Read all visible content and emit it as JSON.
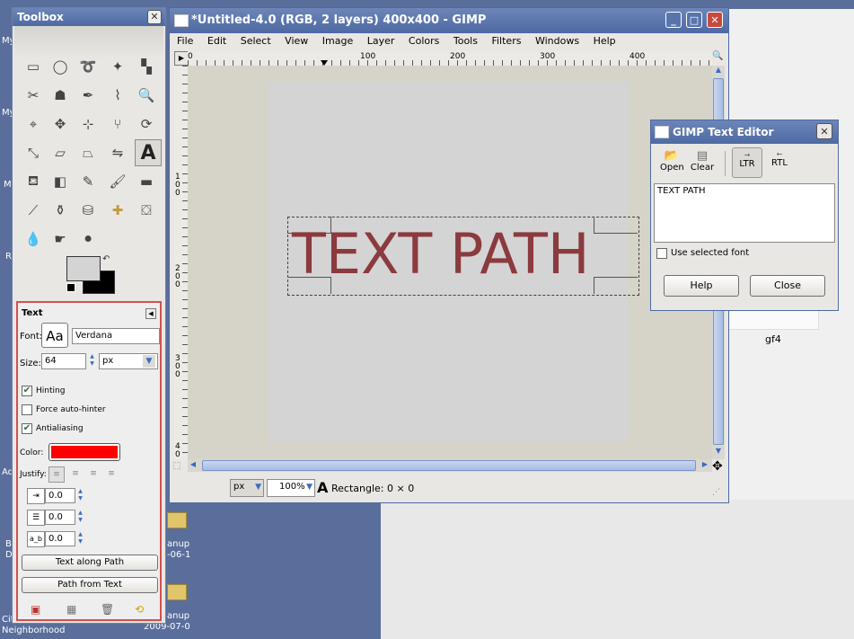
{
  "desktop": {
    "left_labels": [
      "My",
      "My",
      "M",
      "R",
      "Ad",
      "B",
      "D",
      "Cit",
      "Neighborhood"
    ],
    "folders": [
      {
        "line1": "anup",
        "line2": "-06-1"
      },
      {
        "line1": "anup",
        "line2": "2009-07-0"
      }
    ],
    "file_label": "gf4"
  },
  "toolbox": {
    "title": "Toolbox",
    "close": "✕",
    "tool_options": {
      "title": "Text",
      "font_label": "Font:",
      "font_preview": "Aa",
      "font_value": "Verdana",
      "size_label": "Size:",
      "size_value": "64",
      "unit_value": "px",
      "hinting_label": "Hinting",
      "hinting": "✔",
      "force_autohinter_label": "Force auto-hinter",
      "force_autohinter": "",
      "antialiasing_label": "Antialiasing",
      "antialiasing": "✔",
      "color_label": "Color:",
      "color_value": "#ff0000",
      "justify_label": "Justify:",
      "indent_value": "0.0",
      "line_spacing_value": "0.0",
      "letter_spacing_value": "0.0",
      "letter_spacing_icon": "a_b",
      "text_along_path_label": "Text along Path",
      "path_from_text_label": "Path from Text"
    }
  },
  "gimp": {
    "title": "*Untitled-4.0 (RGB, 2 layers) 400x400 - GIMP",
    "menu": [
      "File",
      "Edit",
      "Select",
      "View",
      "Image",
      "Layer",
      "Colors",
      "Tools",
      "Filters",
      "Windows",
      "Help"
    ],
    "ruler_h_labels": [
      "0",
      "100",
      "200",
      "300",
      "400"
    ],
    "ruler_v_labels": [
      "1\n0\n0",
      "2\n0\n0",
      "3\n0\n0",
      "4\n0"
    ],
    "canvas_text": "TEXT PATH",
    "canvas_text_color": "#8b3a3e",
    "status": {
      "unit": "px",
      "zoom": "100%",
      "message": "Rectangle: 0 × 0"
    }
  },
  "text_editor": {
    "title": "GIMP Text Editor",
    "open_label": "Open",
    "clear_label": "Clear",
    "ltr_label": "LTR",
    "rtl_label": "RTL",
    "text_content": "TEXT PATH",
    "use_selected_font_label": "Use selected font",
    "help_label": "Help",
    "close_label": "Close"
  }
}
